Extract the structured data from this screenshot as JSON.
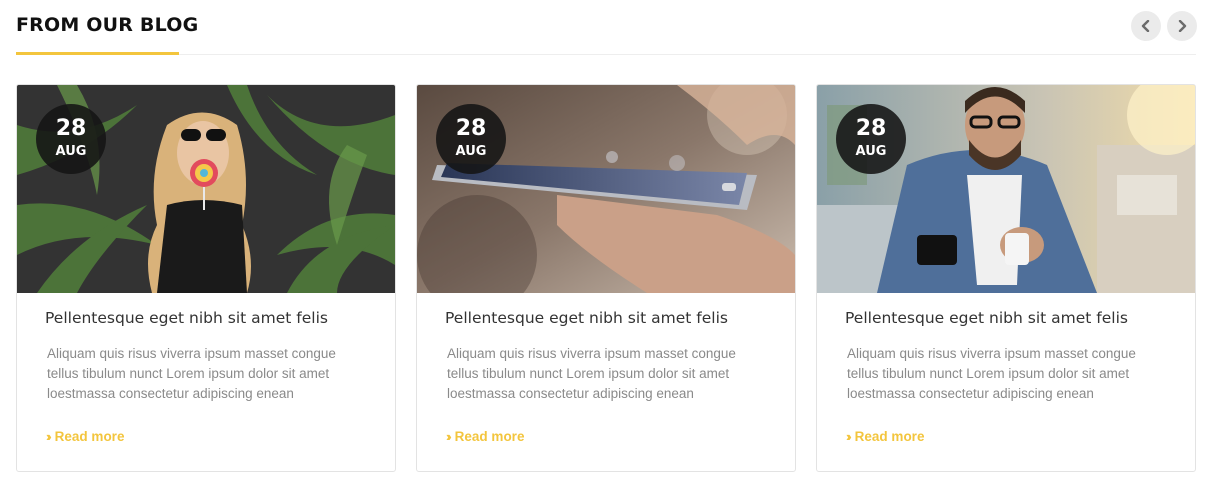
{
  "section": {
    "title": "FROM OUR BLOG",
    "prev_icon": "chevron-left-icon",
    "next_icon": "chevron-right-icon"
  },
  "colors": {
    "accent": "#f3c53d",
    "title": "#111111",
    "excerpt": "#8a8a8a",
    "badge": "#141414"
  },
  "posts": [
    {
      "date_day": "28",
      "date_month": "AUG",
      "title": "Pellentesque eget nibh sit amet felis",
      "excerpt": "Aliquam quis risus viverra  ipsum masset  congue tellus tibulum nunct Lorem ipsum dolor sit amet loestmassa consectetur adipiscing  enean",
      "read_more": "Read more",
      "image": "woman-with-lollipop-palm-leaves"
    },
    {
      "date_day": "28",
      "date_month": "AUG",
      "title": "Pellentesque eget nibh sit amet felis",
      "excerpt": "Aliquam quis risus viverra  ipsum masset  congue tellus tibulum nunct Lorem ipsum dolor sit amet loestmassa consectetur adipiscing  enean",
      "read_more": "Read more",
      "image": "hand-holding-smartphone"
    },
    {
      "date_day": "28",
      "date_month": "AUG",
      "title": "Pellentesque eget nibh sit amet felis",
      "excerpt": "Aliquam quis risus viverra  ipsum masset  congue tellus tibulum nunct Lorem ipsum dolor sit amet loestmassa consectetur adipiscing  enean",
      "read_more": "Read more",
      "image": "man-with-phone-and-coffee"
    }
  ]
}
